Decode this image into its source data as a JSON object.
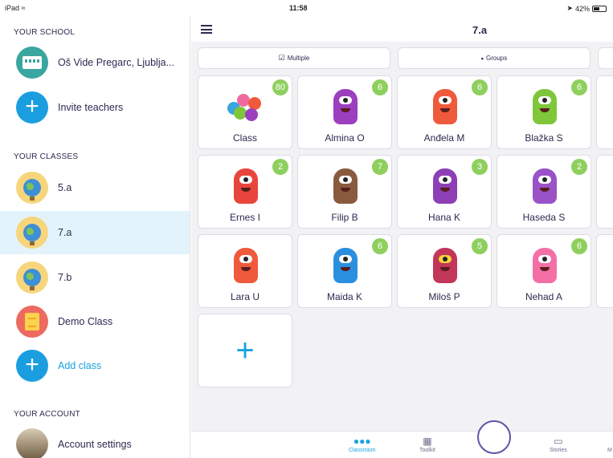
{
  "status_bar": {
    "device": "iPad",
    "time": "11:58",
    "battery": "42%"
  },
  "sidebar": {
    "school_section_title": "YOUR SCHOOL",
    "school_name": "Oš Vide Pregarc, Ljublja...",
    "invite_label": "Invite teachers",
    "classes_section_title": "YOUR CLASSES",
    "classes": [
      {
        "name": "5.a"
      },
      {
        "name": "7.a"
      },
      {
        "name": "7.b"
      },
      {
        "name": "Demo Class"
      }
    ],
    "add_class_label": "Add class",
    "account_section_title": "YOUR ACCOUNT",
    "account_settings_label": "Account settings"
  },
  "header": {
    "title": "7.a"
  },
  "toolbar": {
    "multiple_label": "Multiple",
    "groups_label": "Groups"
  },
  "students": [
    {
      "name": "Class",
      "points": "80",
      "color": "#f06aa0"
    },
    {
      "name": "Almina O",
      "points": "6",
      "color": "#9b3fbf"
    },
    {
      "name": "Anđela M",
      "points": "6",
      "color": "#ef5a3c"
    },
    {
      "name": "Blažka S",
      "points": "6",
      "color": "#7fc63a"
    },
    {
      "name": "Ernes I",
      "points": "2",
      "color": "#e8463c"
    },
    {
      "name": "Filip B",
      "points": "7",
      "color": "#8a5a3e"
    },
    {
      "name": "Hana K",
      "points": "3",
      "color": "#8d3fb5"
    },
    {
      "name": "Haseda S",
      "points": "2",
      "color": "#9a52c7"
    },
    {
      "name": "Lara U",
      "points": "",
      "color": "#ef5a3c"
    },
    {
      "name": "Maida K",
      "points": "6",
      "color": "#2b8fe0"
    },
    {
      "name": "Miloš P",
      "points": "5",
      "color": "#c2365a"
    },
    {
      "name": "Nehad A",
      "points": "6",
      "color": "#f36fa6"
    }
  ],
  "tabbar": {
    "classroom": "Classroom",
    "toolkit": "Toolkit",
    "stories": "Stories",
    "more": "M"
  },
  "colors": {
    "accent": "#18a3e0",
    "badge": "#8ecf5e",
    "selected_row": "#e3f3fb"
  }
}
